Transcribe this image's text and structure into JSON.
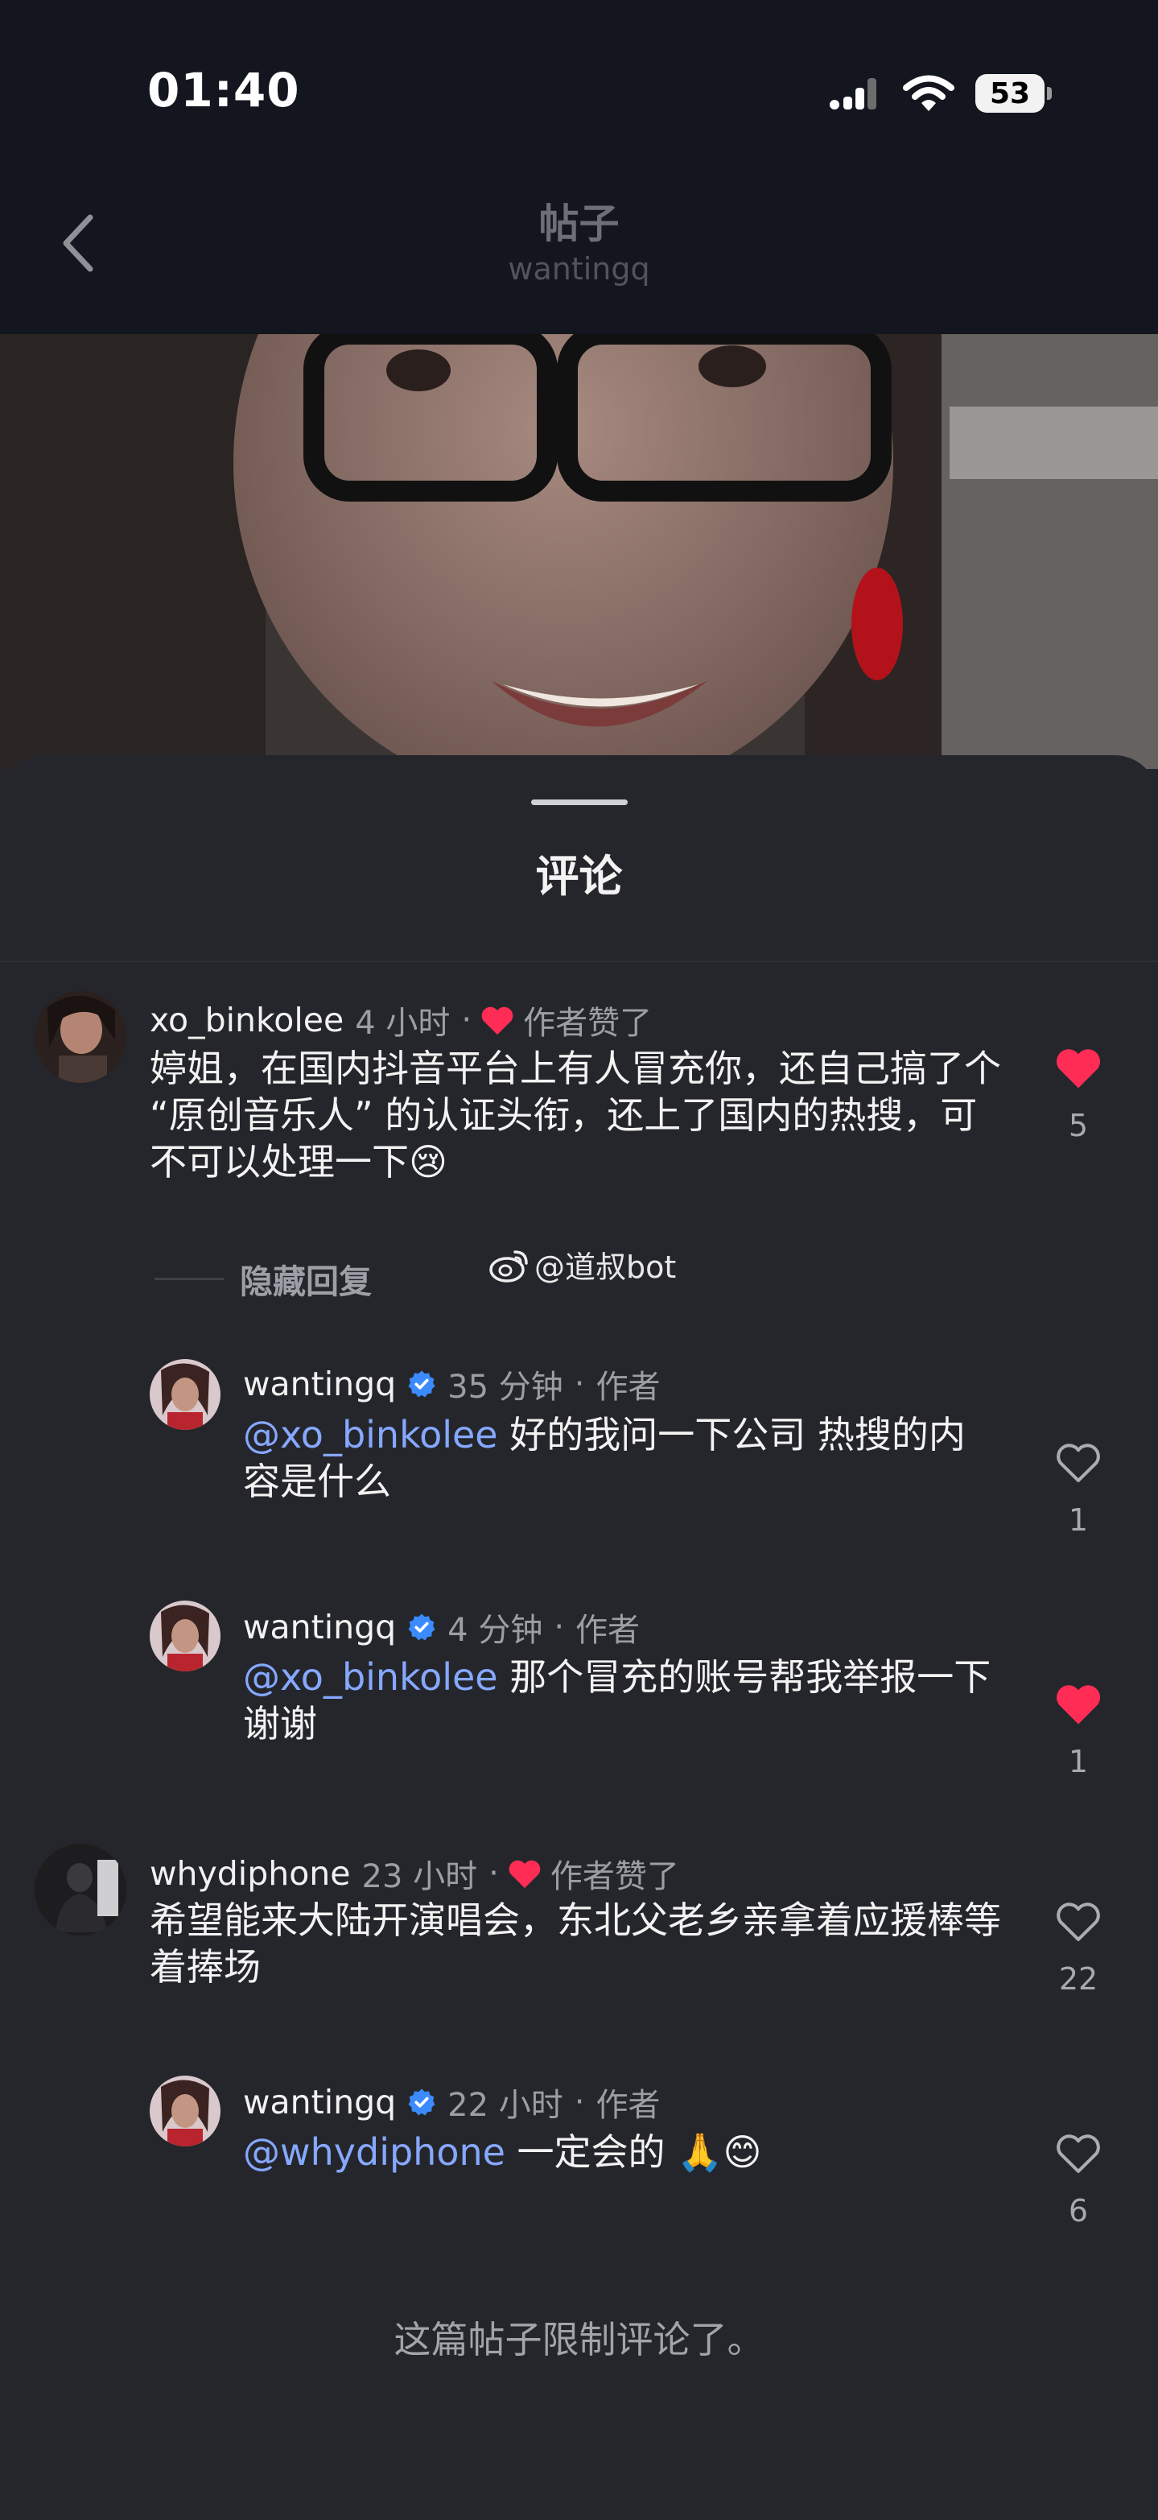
{
  "status_bar": {
    "time": "01:40",
    "battery": "53"
  },
  "nav": {
    "title": "帖子",
    "subtitle": "wantingq"
  },
  "sheet": {
    "title": "评论",
    "hide_replies_label": "隐藏回复",
    "watermark": "@道叔bot",
    "footer": "这篇帖子限制评论了。"
  },
  "comments": [
    {
      "username": "xo_binkolee",
      "time": "4 小时",
      "separator": "·",
      "badge": "作者赞了",
      "text": "婷姐，在国内抖音平台上有人冒充你，还自己搞了个 “原创音乐人” 的认证头衔，还上了国内的热搜，可不可以处理一下",
      "emoji": "😢",
      "likes": "5",
      "liked": true
    },
    {
      "username": "wantingq",
      "time": "35 分钟",
      "separator": "·",
      "role": "作者",
      "mention": "@xo_binkolee",
      "text": " 好的我问一下公司 热搜的内容是什么",
      "likes": "1",
      "liked": false
    },
    {
      "username": "wantingq",
      "time": "4 分钟",
      "separator": "·",
      "role": "作者",
      "mention": "@xo_binkolee",
      "text": " 那个冒充的账号帮我举报一下 谢谢",
      "likes": "1",
      "liked": true
    },
    {
      "username": "whydiphone",
      "time": "23 小时",
      "separator": "·",
      "badge": "作者赞了",
      "text": "希望能来大陆开演唱会，东北父老乡亲拿着应援棒等着捧场",
      "likes": "22",
      "liked": false
    },
    {
      "username": "wantingq",
      "time": "22 小时",
      "separator": "·",
      "role": "作者",
      "mention": "@whydiphone",
      "text": " 一定会的 🙏😊",
      "likes": "6",
      "liked": false
    }
  ],
  "colors": {
    "background": "#24262b",
    "header": "#13161e",
    "mention": "#86a8ff",
    "like_red": "#ff2d55",
    "verified_blue": "#3b8bff"
  }
}
